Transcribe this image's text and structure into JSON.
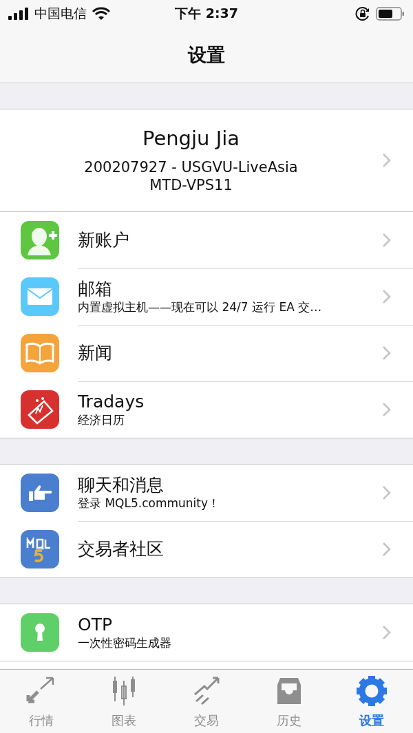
{
  "status_bar": {
    "carrier": "中国电信",
    "time": "下午 2:37"
  },
  "nav_bar": {
    "title": "设置"
  },
  "account": {
    "name": "Pengju Jia",
    "line_1": "200207927 - USGVU-LiveAsia",
    "line_2": "MTD-VPS11"
  },
  "groups": [
    {
      "items": [
        {
          "title": "新账户"
        },
        {
          "title": "邮箱",
          "subtitle": "内置虚拟主机——现在可以 24/7 运行 EA 交…"
        },
        {
          "title": "新闻"
        },
        {
          "title": "Tradays",
          "subtitle": "经济日历"
        }
      ]
    },
    {
      "items": [
        {
          "title": "聊天和消息",
          "subtitle": "登录 MQL5.community！"
        },
        {
          "title": "交易者社区"
        }
      ]
    },
    {
      "items": [
        {
          "title": "OTP",
          "subtitle": "一次性密码生成器"
        }
      ]
    }
  ],
  "tab_bar": [
    {
      "label": "行情",
      "selected": false
    },
    {
      "label": "图表",
      "selected": false
    },
    {
      "label": "交易",
      "selected": false
    },
    {
      "label": "历史",
      "selected": false
    },
    {
      "label": "设置",
      "selected": true
    }
  ]
}
